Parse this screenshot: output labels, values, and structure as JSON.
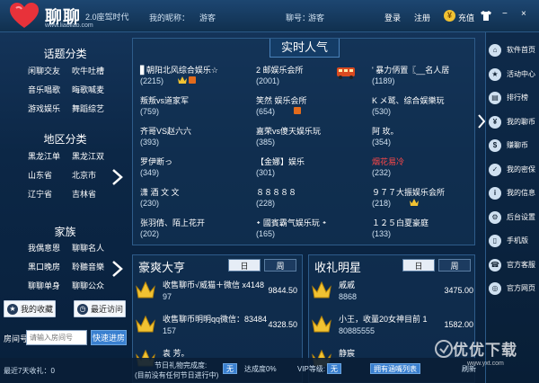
{
  "header": {
    "app_name": "聊聊",
    "tagline": "2.0座驾时代",
    "site": "www.liaoliao.com",
    "nickname_label": "我的昵称：",
    "nickname_value": "游客",
    "number_label": "聊号：",
    "number_value": "游客",
    "login": "登录",
    "register": "注册",
    "recharge": "充值",
    "coin_icon": "yen-coin-icon",
    "shirt_icon": "shirt-icon",
    "window_controls": {
      "minimize": "−",
      "close": "×"
    }
  },
  "left": {
    "topics_title": "话题分类",
    "topics": [
      "闲聊交友",
      "吹牛吐槽",
      "音乐唱歌",
      "晦歌喊麦",
      "游戏娱乐",
      "舞蹈综艺"
    ],
    "regions_title": "地区分类",
    "regions": [
      "黑龙江单",
      "黑龙江双",
      "山东省",
      "北京市",
      "辽宁省",
      "吉林省"
    ],
    "family_title": "家族",
    "families": [
      "我偶意恩",
      "聊聊名人",
      "黑口晚房",
      "聆聽音樂",
      "聊聊单身",
      "聊聊公众"
    ],
    "favorites_label": "我的收藏",
    "recent_label": "最近访问",
    "room_label": "房间号",
    "room_placeholder": "请输入房间号",
    "room_button": "快速进房",
    "recent_income": "最近7天收礼：0"
  },
  "hot": {
    "title": "实时人气",
    "rooms": [
      {
        "name": "▋朝阳北风综合娱乐☆",
        "count": "(2215)",
        "crown": true,
        "badge": true
      },
      {
        "name": "2 邮娱乐会所",
        "count": "(2001)",
        "bus": true
      },
      {
        "name": "' 暴力㑂置〖__名人居",
        "count": "(1189)"
      },
      {
        "name": "叛叛vs道家军",
        "count": "(759)"
      },
      {
        "name": "笑然  娱乐会所",
        "count": "(654)",
        "badge": true
      },
      {
        "name": "K メ鹫、综合娱樂玩",
        "count": "(530)"
      },
      {
        "name": "齐哥VS赵六六",
        "count": "(393)"
      },
      {
        "name": "嘉荣vs傻天娱乐玩",
        "count": "(385)"
      },
      {
        "name": "阿  玫。",
        "count": "(354)"
      },
      {
        "name": "罗伊断っ",
        "count": "(349)"
      },
      {
        "name": "【金娜】娱乐",
        "count": "(301)"
      },
      {
        "name": "烟花易冷",
        "count": "(232)",
        "red": true
      },
      {
        "name": "潇  酒  文  文",
        "count": "(230)"
      },
      {
        "name": "８８８８８",
        "count": "(228)"
      },
      {
        "name": "９７７大振娱乐会所",
        "count": "(218)",
        "crown": true
      },
      {
        "name": "张羽倩、陌上花开",
        "count": "(202)"
      },
      {
        "name": "᛭ 國賓霸气娱乐玩 ᛭",
        "count": "(165)"
      },
      {
        "name": "１２５白夏豪庭",
        "count": "(133)"
      }
    ]
  },
  "rich": {
    "title": "豪爽大亨",
    "tab_day": "日",
    "tab_week": "周",
    "rows": [
      {
        "name": "收售聊币√威猫＋微信 x4148",
        "sub": "97",
        "value": "9844.50"
      },
      {
        "name": "收售聊币明明qq微信：83484",
        "sub": "157",
        "value": "4328.50"
      },
      {
        "name": "袁  芳。",
        "sub": "",
        "value": ""
      }
    ]
  },
  "stars": {
    "title": "收礼明星",
    "tab_day": "日",
    "tab_week": "周",
    "rows": [
      {
        "name": "戚戚",
        "sub": "8868",
        "value": "3475.00"
      },
      {
        "name": "小王，收量20女神目前 1",
        "sub": "80885555",
        "value": "1582.00"
      },
      {
        "name": "静宸",
        "sub": "",
        "value": ""
      }
    ]
  },
  "status": {
    "festival_label": "节日礼物完成度:",
    "festival_sub": "(目前没有任何节日进行中)",
    "none_1": "无",
    "completion": "达成度0%",
    "vip_label": "VIP等级:",
    "none_2": "无",
    "card_status": "拥有涵嘴列表",
    "refresh": "刷新"
  },
  "sidebar": [
    {
      "label": "软件首页",
      "icon": "home-icon"
    },
    {
      "label": "活动中心",
      "icon": "gift-icon"
    },
    {
      "label": "排行榜",
      "icon": "chart-icon"
    },
    {
      "label": "我的聊币",
      "icon": "coin-icon"
    },
    {
      "label": "赚聊币",
      "icon": "money-icon"
    },
    {
      "label": "我的密保",
      "icon": "shield-icon"
    },
    {
      "label": "我的信息",
      "icon": "info-icon"
    },
    {
      "label": "后台设置",
      "icon": "settings-icon"
    },
    {
      "label": "手机版",
      "icon": "phone-icon"
    },
    {
      "label": "官方客服",
      "icon": "headset-icon"
    },
    {
      "label": "官方网页",
      "icon": "globe-icon"
    }
  ],
  "watermark": {
    "text": "优优下载",
    "url": "www.yxt.com"
  }
}
